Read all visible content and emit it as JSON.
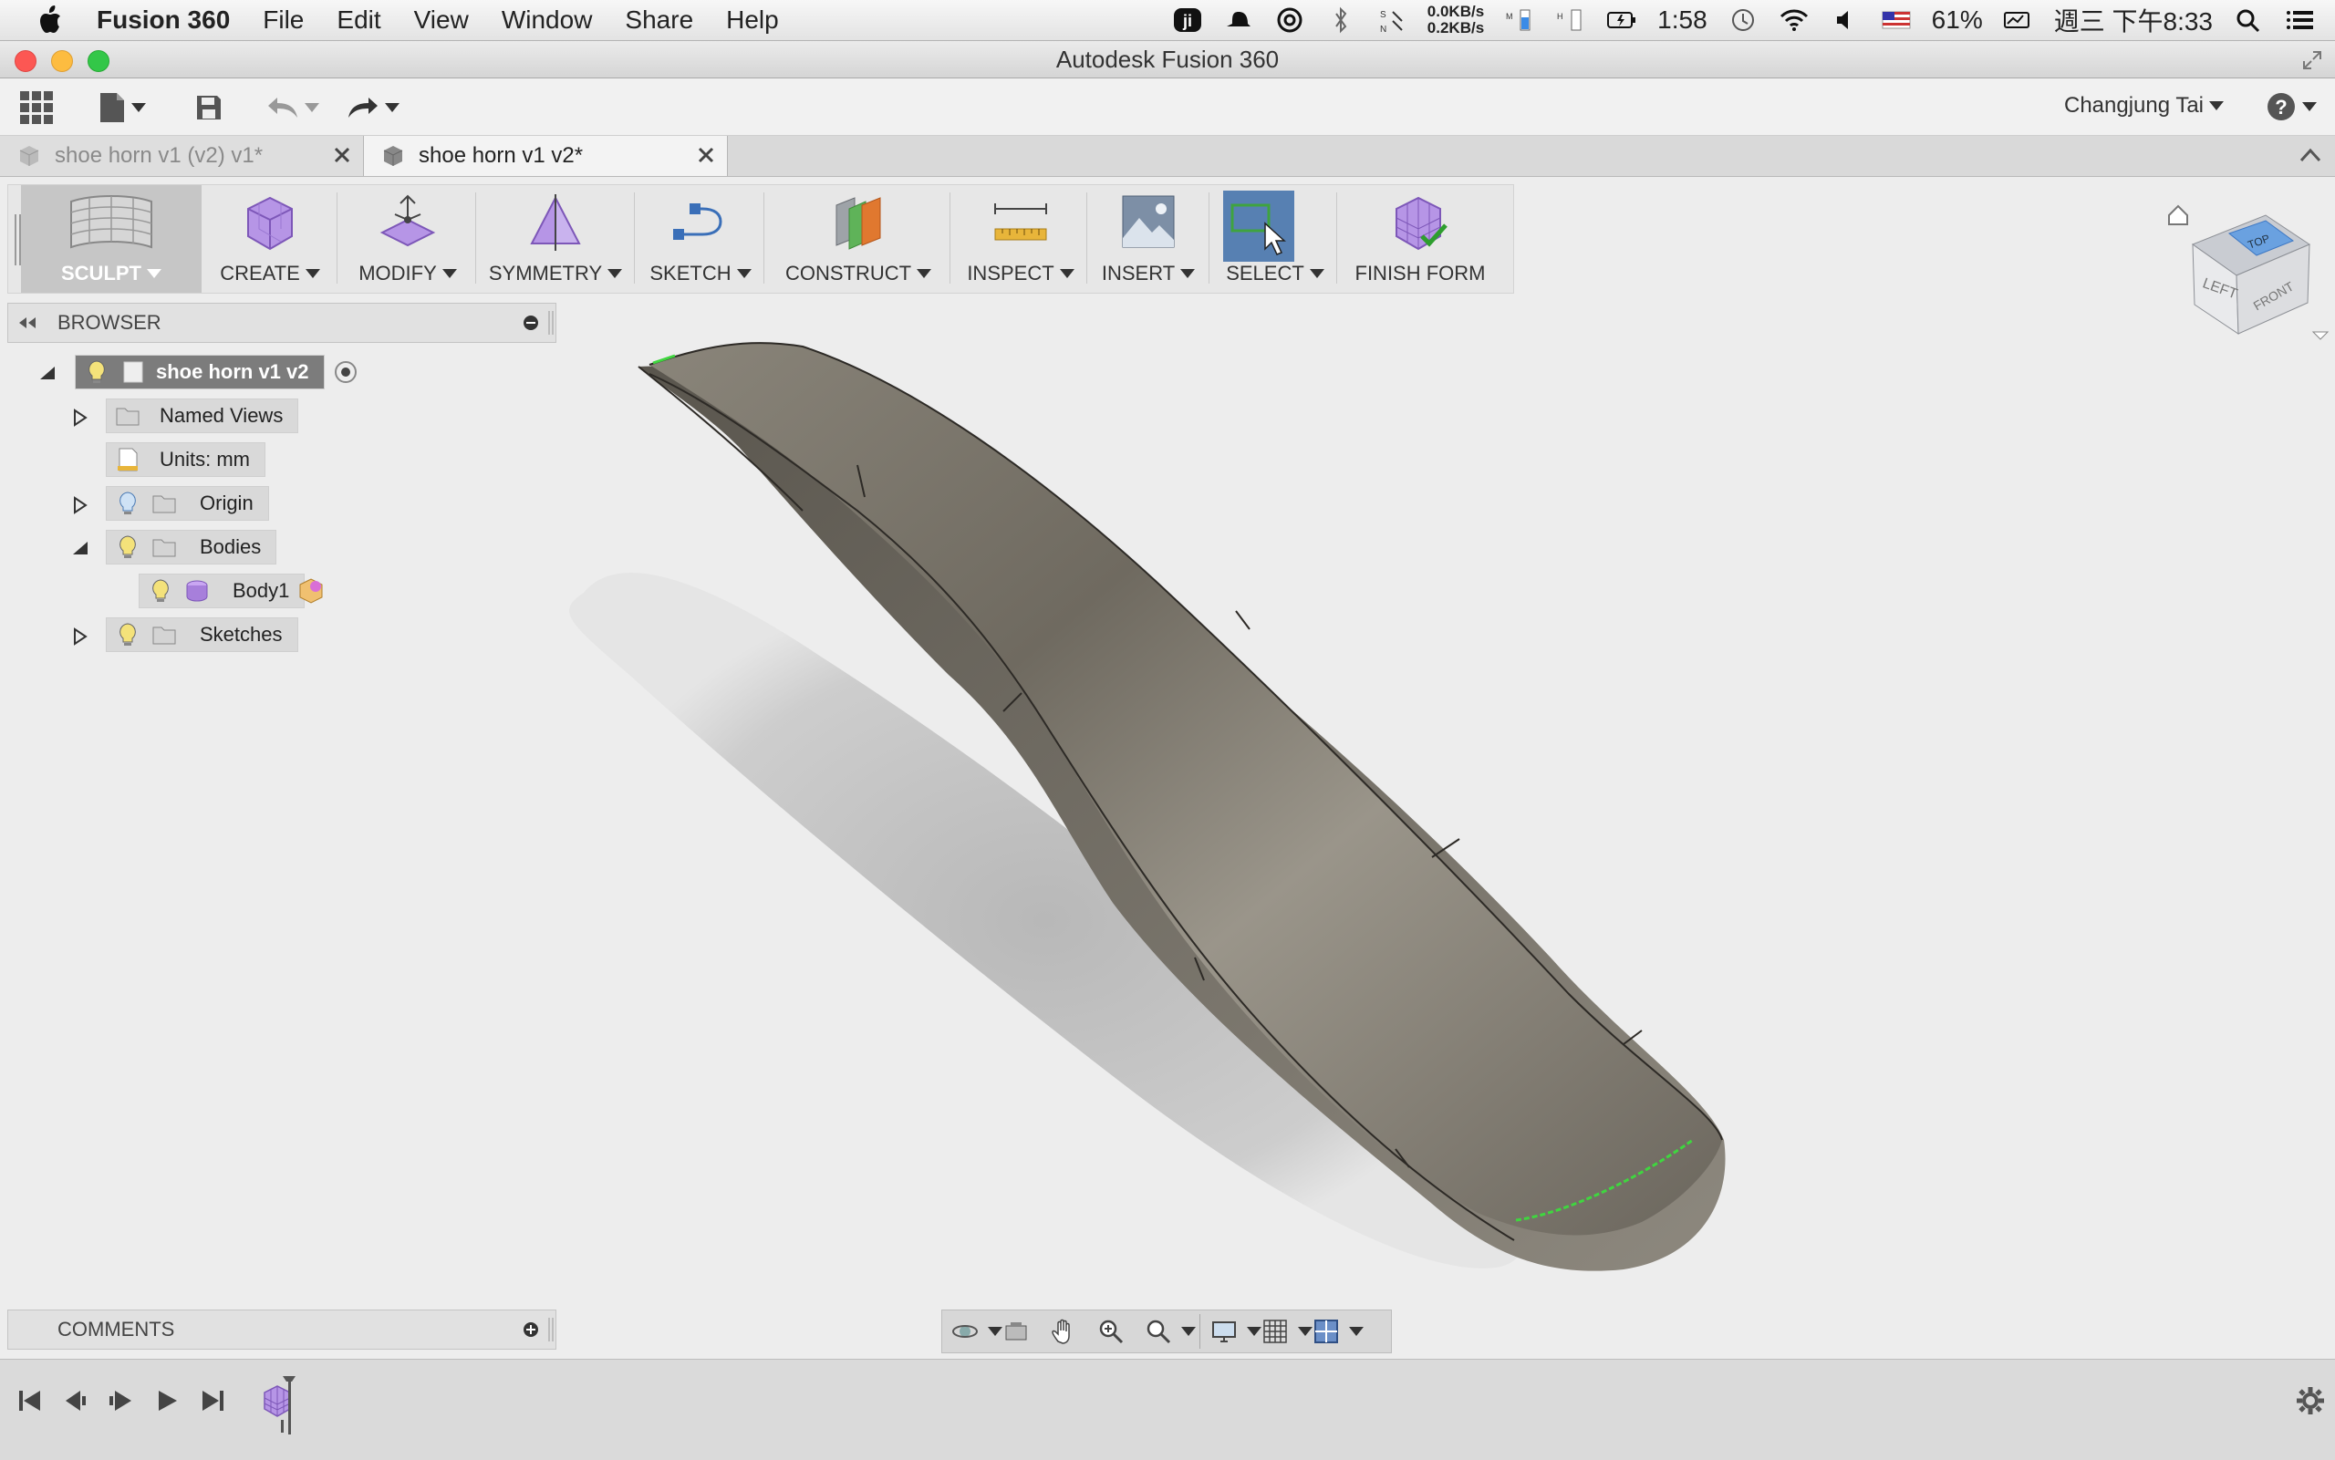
{
  "menubar": {
    "app_name": "Fusion 360",
    "menus": [
      "File",
      "Edit",
      "View",
      "Window",
      "Share",
      "Help"
    ],
    "net_up": "0.0KB/s",
    "net_down": "0.2KB/s",
    "battery_time": "1:58",
    "battery_percent": "61%",
    "clock": "週三 下午8:33"
  },
  "window": {
    "title": "Autodesk Fusion 360"
  },
  "toolbar": {
    "user_name": "Changjung Tai"
  },
  "tabs": [
    {
      "label": "shoe horn v1 (v2) v1*",
      "active": false
    },
    {
      "label": "shoe horn v1 v2*",
      "active": true
    }
  ],
  "ribbon": {
    "workspace": "SCULPT",
    "groups": [
      "CREATE",
      "MODIFY",
      "SYMMETRY",
      "SKETCH",
      "CONSTRUCT",
      "INSPECT",
      "INSERT",
      "SELECT",
      "FINISH FORM"
    ]
  },
  "viewcube": {
    "faces": [
      "LEFT",
      "FRONT",
      "TOP"
    ]
  },
  "browser": {
    "title": "BROWSER",
    "root": "shoe horn v1 v2",
    "items": [
      "Named Views",
      "Units: mm",
      "Origin",
      "Bodies",
      "Body1",
      "Sketches"
    ]
  },
  "comments": {
    "title": "COMMENTS"
  },
  "colors": {
    "accent_select": "#5780b2",
    "sculpt_purple": "#a77fdb",
    "model_surface": "#7c776d",
    "edge_highlight": "#3fd63f"
  }
}
